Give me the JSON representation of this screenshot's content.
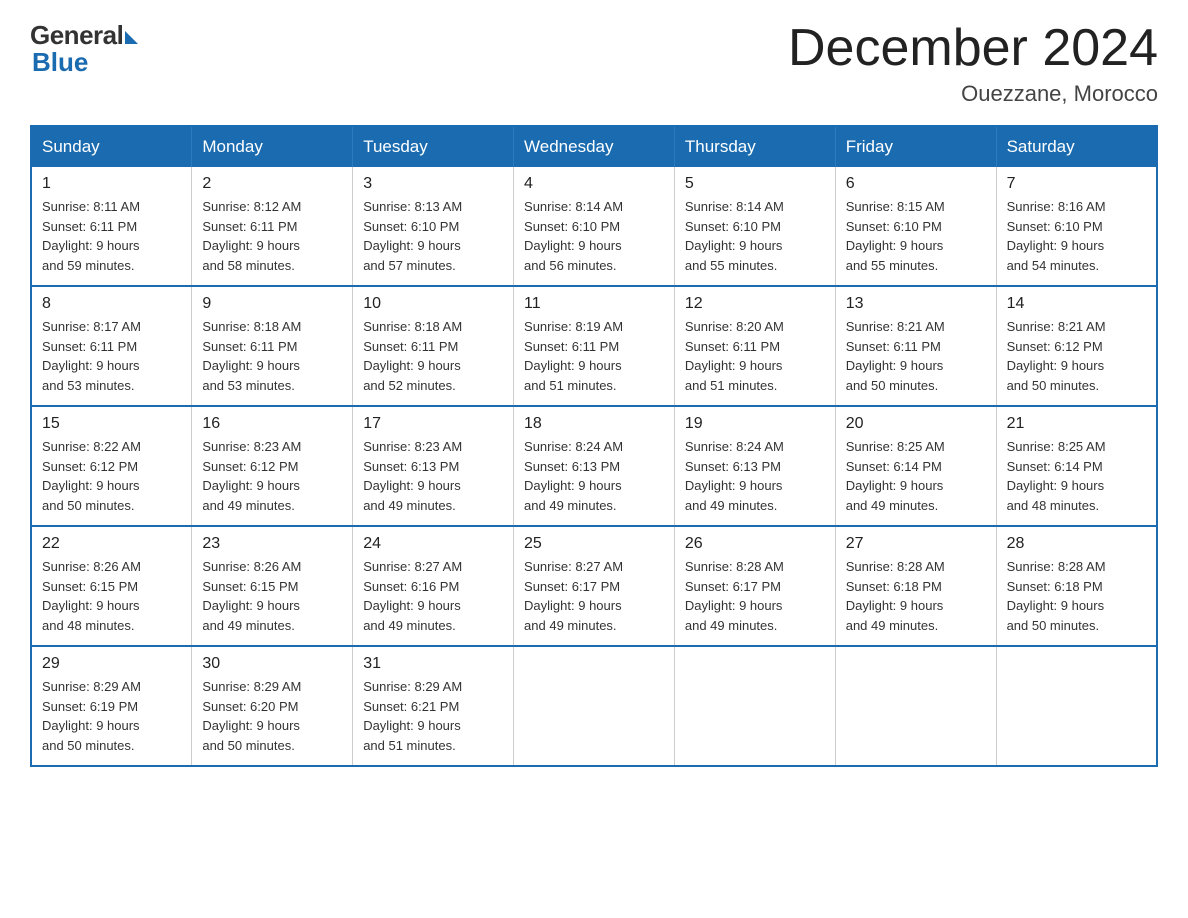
{
  "logo": {
    "general": "General",
    "blue": "Blue"
  },
  "title": {
    "month": "December 2024",
    "location": "Ouezzane, Morocco"
  },
  "header": {
    "days": [
      "Sunday",
      "Monday",
      "Tuesday",
      "Wednesday",
      "Thursday",
      "Friday",
      "Saturday"
    ]
  },
  "weeks": [
    [
      {
        "day": "1",
        "sunrise": "8:11 AM",
        "sunset": "6:11 PM",
        "daylight": "9 hours and 59 minutes."
      },
      {
        "day": "2",
        "sunrise": "8:12 AM",
        "sunset": "6:11 PM",
        "daylight": "9 hours and 58 minutes."
      },
      {
        "day": "3",
        "sunrise": "8:13 AM",
        "sunset": "6:10 PM",
        "daylight": "9 hours and 57 minutes."
      },
      {
        "day": "4",
        "sunrise": "8:14 AM",
        "sunset": "6:10 PM",
        "daylight": "9 hours and 56 minutes."
      },
      {
        "day": "5",
        "sunrise": "8:14 AM",
        "sunset": "6:10 PM",
        "daylight": "9 hours and 55 minutes."
      },
      {
        "day": "6",
        "sunrise": "8:15 AM",
        "sunset": "6:10 PM",
        "daylight": "9 hours and 55 minutes."
      },
      {
        "day": "7",
        "sunrise": "8:16 AM",
        "sunset": "6:10 PM",
        "daylight": "9 hours and 54 minutes."
      }
    ],
    [
      {
        "day": "8",
        "sunrise": "8:17 AM",
        "sunset": "6:11 PM",
        "daylight": "9 hours and 53 minutes."
      },
      {
        "day": "9",
        "sunrise": "8:18 AM",
        "sunset": "6:11 PM",
        "daylight": "9 hours and 53 minutes."
      },
      {
        "day": "10",
        "sunrise": "8:18 AM",
        "sunset": "6:11 PM",
        "daylight": "9 hours and 52 minutes."
      },
      {
        "day": "11",
        "sunrise": "8:19 AM",
        "sunset": "6:11 PM",
        "daylight": "9 hours and 51 minutes."
      },
      {
        "day": "12",
        "sunrise": "8:20 AM",
        "sunset": "6:11 PM",
        "daylight": "9 hours and 51 minutes."
      },
      {
        "day": "13",
        "sunrise": "8:21 AM",
        "sunset": "6:11 PM",
        "daylight": "9 hours and 50 minutes."
      },
      {
        "day": "14",
        "sunrise": "8:21 AM",
        "sunset": "6:12 PM",
        "daylight": "9 hours and 50 minutes."
      }
    ],
    [
      {
        "day": "15",
        "sunrise": "8:22 AM",
        "sunset": "6:12 PM",
        "daylight": "9 hours and 50 minutes."
      },
      {
        "day": "16",
        "sunrise": "8:23 AM",
        "sunset": "6:12 PM",
        "daylight": "9 hours and 49 minutes."
      },
      {
        "day": "17",
        "sunrise": "8:23 AM",
        "sunset": "6:13 PM",
        "daylight": "9 hours and 49 minutes."
      },
      {
        "day": "18",
        "sunrise": "8:24 AM",
        "sunset": "6:13 PM",
        "daylight": "9 hours and 49 minutes."
      },
      {
        "day": "19",
        "sunrise": "8:24 AM",
        "sunset": "6:13 PM",
        "daylight": "9 hours and 49 minutes."
      },
      {
        "day": "20",
        "sunrise": "8:25 AM",
        "sunset": "6:14 PM",
        "daylight": "9 hours and 49 minutes."
      },
      {
        "day": "21",
        "sunrise": "8:25 AM",
        "sunset": "6:14 PM",
        "daylight": "9 hours and 48 minutes."
      }
    ],
    [
      {
        "day": "22",
        "sunrise": "8:26 AM",
        "sunset": "6:15 PM",
        "daylight": "9 hours and 48 minutes."
      },
      {
        "day": "23",
        "sunrise": "8:26 AM",
        "sunset": "6:15 PM",
        "daylight": "9 hours and 49 minutes."
      },
      {
        "day": "24",
        "sunrise": "8:27 AM",
        "sunset": "6:16 PM",
        "daylight": "9 hours and 49 minutes."
      },
      {
        "day": "25",
        "sunrise": "8:27 AM",
        "sunset": "6:17 PM",
        "daylight": "9 hours and 49 minutes."
      },
      {
        "day": "26",
        "sunrise": "8:28 AM",
        "sunset": "6:17 PM",
        "daylight": "9 hours and 49 minutes."
      },
      {
        "day": "27",
        "sunrise": "8:28 AM",
        "sunset": "6:18 PM",
        "daylight": "9 hours and 49 minutes."
      },
      {
        "day": "28",
        "sunrise": "8:28 AM",
        "sunset": "6:18 PM",
        "daylight": "9 hours and 50 minutes."
      }
    ],
    [
      {
        "day": "29",
        "sunrise": "8:29 AM",
        "sunset": "6:19 PM",
        "daylight": "9 hours and 50 minutes."
      },
      {
        "day": "30",
        "sunrise": "8:29 AM",
        "sunset": "6:20 PM",
        "daylight": "9 hours and 50 minutes."
      },
      {
        "day": "31",
        "sunrise": "8:29 AM",
        "sunset": "6:21 PM",
        "daylight": "9 hours and 51 minutes."
      },
      null,
      null,
      null,
      null
    ]
  ],
  "labels": {
    "sunrise": "Sunrise:",
    "sunset": "Sunset:",
    "daylight": "Daylight:"
  }
}
